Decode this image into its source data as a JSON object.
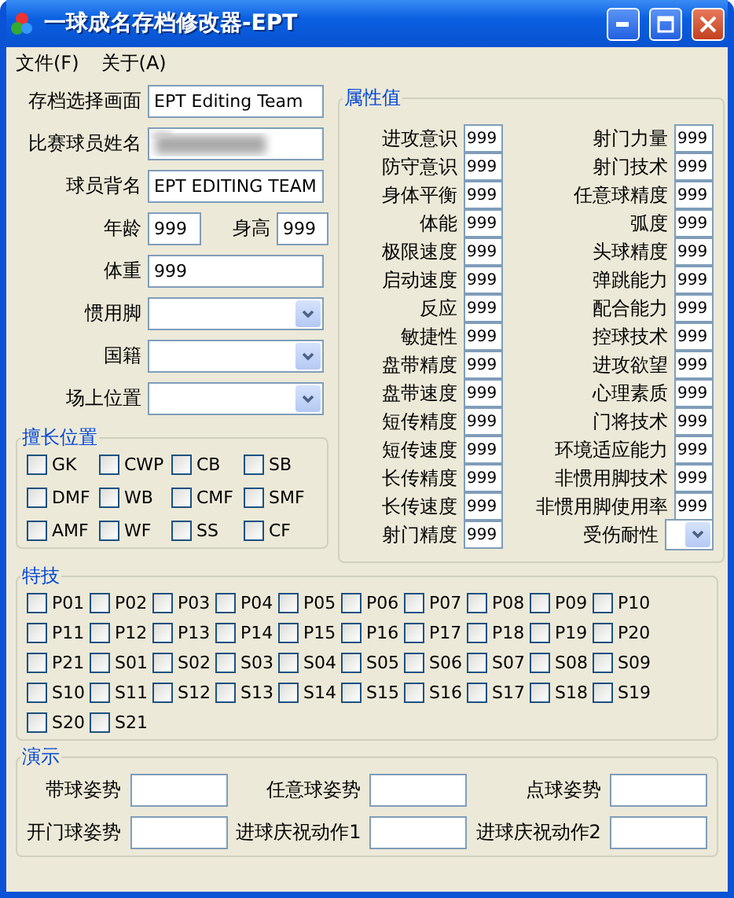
{
  "window": {
    "title": "一球成名存档修改器-EPT"
  },
  "menu": [
    {
      "label": "文件(F)"
    },
    {
      "label": "关于(A)"
    }
  ],
  "profile": [
    {
      "kind": "text",
      "label": "存档选择画面",
      "value": "EPT Editing Team"
    },
    {
      "kind": "redacted",
      "label": "比赛球员姓名"
    },
    {
      "kind": "text",
      "label": "球员背名",
      "value": "EPT EDITING TEAM"
    },
    {
      "kind": "pair",
      "items": [
        {
          "label": "年龄",
          "value": "999"
        },
        {
          "label": "身高",
          "value": "999"
        }
      ]
    },
    {
      "kind": "text",
      "label": "体重",
      "value": "999"
    },
    {
      "kind": "select",
      "label": "惯用脚"
    },
    {
      "kind": "select",
      "label": "国籍"
    },
    {
      "kind": "select",
      "label": "场上位置"
    }
  ],
  "positions": {
    "title": "擅长位置",
    "items": [
      {
        "label": "GK",
        "checked": false
      },
      {
        "label": "CWP",
        "checked": false
      },
      {
        "label": "CB",
        "checked": false
      },
      {
        "label": "SB",
        "checked": false
      },
      {
        "label": "DMF",
        "checked": false
      },
      {
        "label": "WB",
        "checked": false
      },
      {
        "label": "CMF",
        "checked": false
      },
      {
        "label": "SMF",
        "checked": false
      },
      {
        "label": "AMF",
        "checked": false
      },
      {
        "label": "WF",
        "checked": false
      },
      {
        "label": "SS",
        "checked": false
      },
      {
        "label": "CF",
        "checked": false
      }
    ]
  },
  "attributes": {
    "title": "属性值",
    "left": [
      {
        "kind": "text",
        "label": "进攻意识",
        "value": "999"
      },
      {
        "kind": "text",
        "label": "防守意识",
        "value": "999"
      },
      {
        "kind": "text",
        "label": "身体平衡",
        "value": "999"
      },
      {
        "kind": "text",
        "label": "体能",
        "value": "999"
      },
      {
        "kind": "text",
        "label": "极限速度",
        "value": "999"
      },
      {
        "kind": "text",
        "label": "启动速度",
        "value": "999"
      },
      {
        "kind": "text",
        "label": "反应",
        "value": "999"
      },
      {
        "kind": "text",
        "label": "敏捷性",
        "value": "999"
      },
      {
        "kind": "text",
        "label": "盘带精度",
        "value": "999"
      },
      {
        "kind": "text",
        "label": "盘带速度",
        "value": "999"
      },
      {
        "kind": "text",
        "label": "短传精度",
        "value": "999"
      },
      {
        "kind": "text",
        "label": "短传速度",
        "value": "999"
      },
      {
        "kind": "text",
        "label": "长传精度",
        "value": "999"
      },
      {
        "kind": "text",
        "label": "长传速度",
        "value": "999"
      },
      {
        "kind": "text",
        "label": "射门精度",
        "value": "999"
      }
    ],
    "right": [
      {
        "kind": "text",
        "label": "射门力量",
        "value": "999"
      },
      {
        "kind": "text",
        "label": "射门技术",
        "value": "999"
      },
      {
        "kind": "text",
        "label": "任意球精度",
        "value": "999"
      },
      {
        "kind": "text",
        "label": "弧度",
        "value": "999"
      },
      {
        "kind": "text",
        "label": "头球精度",
        "value": "999"
      },
      {
        "kind": "text",
        "label": "弹跳能力",
        "value": "999"
      },
      {
        "kind": "text",
        "label": "配合能力",
        "value": "999"
      },
      {
        "kind": "text",
        "label": "控球技术",
        "value": "999"
      },
      {
        "kind": "text",
        "label": "进攻欲望",
        "value": "999"
      },
      {
        "kind": "text",
        "label": "心理素质",
        "value": "999"
      },
      {
        "kind": "text",
        "label": "门将技术",
        "value": "999"
      },
      {
        "kind": "text",
        "label": "环境适应能力",
        "value": "999"
      },
      {
        "kind": "text",
        "label": "非惯用脚技术",
        "value": "999"
      },
      {
        "kind": "text",
        "label": "非惯用脚使用率",
        "value": "999"
      },
      {
        "kind": "select",
        "label": "受伤耐性"
      }
    ]
  },
  "skills": {
    "title": "特技",
    "items": [
      {
        "label": "P01",
        "checked": false
      },
      {
        "label": "P02",
        "checked": false
      },
      {
        "label": "P03",
        "checked": false
      },
      {
        "label": "P04",
        "checked": false
      },
      {
        "label": "P05",
        "checked": false
      },
      {
        "label": "P06",
        "checked": false
      },
      {
        "label": "P07",
        "checked": false
      },
      {
        "label": "P08",
        "checked": false
      },
      {
        "label": "P09",
        "checked": false
      },
      {
        "label": "P10",
        "checked": false
      },
      {
        "label": "P11",
        "checked": false
      },
      {
        "label": "P12",
        "checked": false
      },
      {
        "label": "P13",
        "checked": false
      },
      {
        "label": "P14",
        "checked": false
      },
      {
        "label": "P15",
        "checked": false
      },
      {
        "label": "P16",
        "checked": false
      },
      {
        "label": "P17",
        "checked": false
      },
      {
        "label": "P18",
        "checked": false
      },
      {
        "label": "P19",
        "checked": false
      },
      {
        "label": "P20",
        "checked": false
      },
      {
        "label": "P21",
        "checked": false
      },
      {
        "label": "S01",
        "checked": false
      },
      {
        "label": "S02",
        "checked": false
      },
      {
        "label": "S03",
        "checked": false
      },
      {
        "label": "S04",
        "checked": false
      },
      {
        "label": "S05",
        "checked": false
      },
      {
        "label": "S06",
        "checked": false
      },
      {
        "label": "S07",
        "checked": false
      },
      {
        "label": "S08",
        "checked": false
      },
      {
        "label": "S09",
        "checked": false
      },
      {
        "label": "S10",
        "checked": false
      },
      {
        "label": "S11",
        "checked": false
      },
      {
        "label": "S12",
        "checked": false
      },
      {
        "label": "S13",
        "checked": false
      },
      {
        "label": "S14",
        "checked": false
      },
      {
        "label": "S15",
        "checked": false
      },
      {
        "label": "S16",
        "checked": false
      },
      {
        "label": "S17",
        "checked": false
      },
      {
        "label": "S18",
        "checked": false
      },
      {
        "label": "S19",
        "checked": false
      },
      {
        "label": "S20",
        "checked": false
      },
      {
        "label": "S21",
        "checked": false
      }
    ]
  },
  "demo": {
    "title": "演示",
    "items": [
      {
        "label": "带球姿势"
      },
      {
        "label": "任意球姿势"
      },
      {
        "label": "点球姿势"
      },
      {
        "label": "开门球姿势"
      },
      {
        "label": "进球庆祝动作1"
      },
      {
        "label": "进球庆祝动作2"
      }
    ]
  }
}
